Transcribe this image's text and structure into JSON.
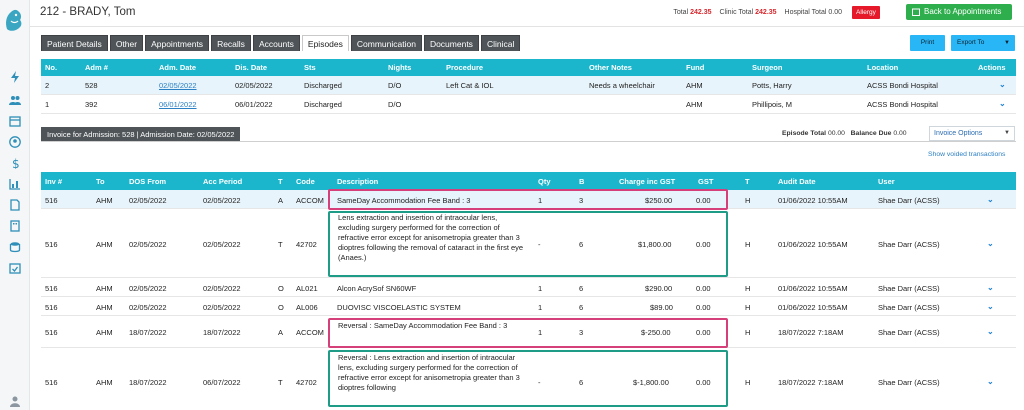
{
  "patient": {
    "title": "212 - BRADY, Tom"
  },
  "totals": {
    "total_label": "Total",
    "total_value": "242.35",
    "clinic_label": "Clinic Total",
    "clinic_value": "242.35",
    "hospital_label": "Hospital Total",
    "hospital_value": "0.00"
  },
  "allergy_label": "Allergy",
  "back_button": "Back to Appointments",
  "tabs": [
    "Patient Details",
    "Other",
    "Appointments",
    "Recalls",
    "Accounts",
    "Episodes",
    "Communication",
    "Documents",
    "Clinical"
  ],
  "active_tab": "Episodes",
  "print_label": "Print",
  "export_label": "Export To",
  "admissions": {
    "headers": [
      "No.",
      "Adm #",
      "Adm. Date",
      "Dis. Date",
      "Sts",
      "Nights",
      "Procedure",
      "Other Notes",
      "Fund",
      "Surgeon",
      "Location",
      "Actions"
    ],
    "rows": [
      [
        "2",
        "528",
        "02/05/2022",
        "02/05/2022",
        "Discharged",
        "D/O",
        "Left Cat & IOL",
        "Needs a wheelchair",
        "AHM",
        "Potts, Harry",
        "ACSS Bondi Hospital"
      ],
      [
        "1",
        "392",
        "06/01/2022",
        "06/01/2022",
        "Discharged",
        "D/O",
        "",
        "",
        "AHM",
        "Phillipois, M",
        "ACSS Bondi Hospital"
      ]
    ]
  },
  "invoice_header": "Invoice for Admission: 528 | Admission Date: 02/05/2022",
  "episode_total_label": "Episode Total",
  "episode_total_value": "00.00",
  "balance_due_label": "Balance Due",
  "balance_due_value": "0.00",
  "invoice_options_label": "Invoice Options",
  "show_voided_label": "Show voided transactions",
  "transactions": {
    "headers": [
      "Inv #",
      "To",
      "DOS From",
      "Acc Period",
      "T",
      "Code",
      "Description",
      "Qty",
      "B",
      "Charge inc GST",
      "GST",
      "T",
      "Audit Date",
      "User"
    ],
    "rows": [
      [
        "516",
        "AHM",
        "02/05/2022",
        "02/05/2022",
        "A",
        "ACCOM",
        "SameDay Accommodation Fee Band : 3",
        "1",
        "3",
        "$250.00",
        "0.00",
        "H",
        "01/06/2022 10:55AM",
        "Shae Darr (ACSS)"
      ],
      [
        "516",
        "AHM",
        "02/05/2022",
        "02/05/2022",
        "T",
        "42702",
        "Lens extraction and insertion of intraocular lens, excluding surgery performed for the correction of refractive error except for anisometropia greater than 3 dioptres following the removal of cataract in the first eye (Anaes.)",
        "-",
        "6",
        "$1,800.00",
        "0.00",
        "H",
        "01/06/2022 10:55AM",
        "Shae Darr (ACSS)"
      ],
      [
        "516",
        "AHM",
        "02/05/2022",
        "02/05/2022",
        "O",
        "AL021",
        "Alcon AcrySof SN60WF",
        "1",
        "6",
        "$290.00",
        "0.00",
        "H",
        "01/06/2022 10:55AM",
        "Shae Darr (ACSS)"
      ],
      [
        "516",
        "AHM",
        "02/05/2022",
        "02/05/2022",
        "O",
        "AL006",
        "DUOVISC VISCOELASTIC SYSTEM",
        "1",
        "6",
        "$89.00",
        "0.00",
        "H",
        "01/06/2022 10:55AM",
        "Shae Darr (ACSS)"
      ],
      [
        "516",
        "AHM",
        "18/07/2022",
        "18/07/2022",
        "A",
        "ACCOM",
        "Reversal : SameDay Accommodation Fee Band : 3",
        "1",
        "3",
        "$-250.00",
        "0.00",
        "H",
        "18/07/2022 7:18AM",
        "Shae Darr (ACSS)"
      ],
      [
        "516",
        "AHM",
        "18/07/2022",
        "06/07/2022",
        "T",
        "42702",
        "Reversal : Lens extraction and insertion of intraocular lens, excluding surgery performed for the correction of refractive error except for anisometropia greater than 3 dioptres following",
        "-",
        "6",
        "$-1,800.00",
        "0.00",
        "H",
        "18/07/2022 7:18AM",
        "Shae Darr (ACSS)"
      ]
    ]
  },
  "colors": {
    "header": "#1bb6cc",
    "tab": "#4f5458",
    "back": "#2fae4e",
    "allergy": "#e6192b",
    "pink_box": "#d6407a",
    "teal_box": "#1f9c88"
  }
}
